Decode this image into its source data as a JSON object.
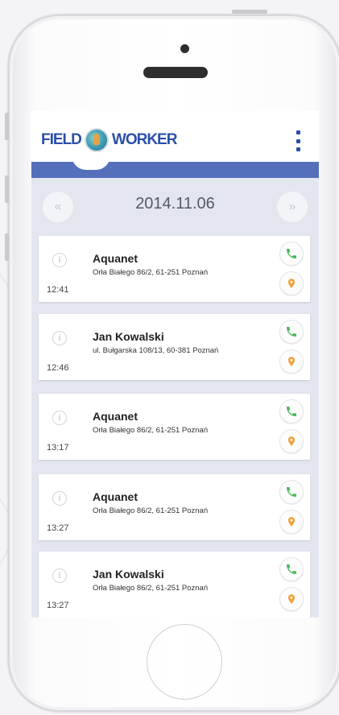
{
  "app": {
    "logo_text_left": "FIELD",
    "logo_text_right": "WORKER",
    "brand_color": "#2a4fa8",
    "bar_color": "#5470bb"
  },
  "date_nav": {
    "prev_label": "«",
    "next_label": "»",
    "date": "2014.11.06"
  },
  "visits": [
    {
      "name": "Aquanet",
      "address": "Orła Białego 86/2, 61-251 Poznań",
      "time": "12:41"
    },
    {
      "name": "Jan Kowalski",
      "address": "ul. Bułgarska 108/13, 60-381 Poznań",
      "time": "12:46"
    },
    {
      "name": "Aquanet",
      "address": "Orła Białego 86/2, 61-251 Poznań",
      "time": "13:17"
    },
    {
      "name": "Aquanet",
      "address": "Orła Białego 86/2, 61-251 Poznań",
      "time": "13:27"
    },
    {
      "name": "Jan Kowalski",
      "address": "Orła Białego 86/2, 61-251 Poznań",
      "time": "13:27"
    }
  ],
  "icons": {
    "info": "info-icon",
    "call": "phone-icon",
    "map": "map-pin-icon",
    "menu": "more-vertical-icon"
  },
  "colors": {
    "call_green": "#4cbb5a",
    "pin_orange": "#f2a23a"
  }
}
